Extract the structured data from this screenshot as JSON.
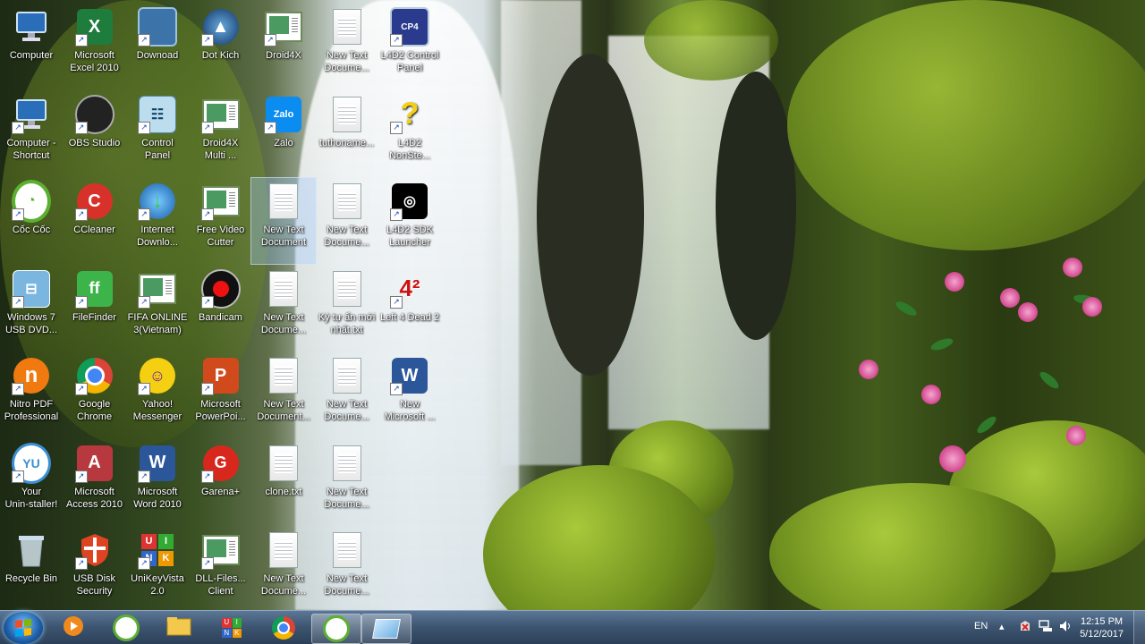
{
  "desktop": {
    "icons": [
      {
        "label": "Computer",
        "type": "computer"
      },
      {
        "label": "Microsoft\nExcel 2010",
        "type": "excel"
      },
      {
        "label": "Downoad",
        "type": "folder-blue"
      },
      {
        "label": "Dot Kich",
        "type": "dotkich"
      },
      {
        "label": "Droid4X",
        "type": "win"
      },
      {
        "label": "New Text\nDocume...",
        "type": "doc"
      },
      {
        "label": "L4D2 Control\nPanel",
        "type": "l4d2cp"
      },
      {
        "label": "Computer -\nShortcut",
        "type": "computer"
      },
      {
        "label": "OBS Studio",
        "type": "obs"
      },
      {
        "label": "Control\nPanel",
        "type": "controlpanel"
      },
      {
        "label": "Droid4X\nMulti ...",
        "type": "win"
      },
      {
        "label": "Zalo",
        "type": "zalo"
      },
      {
        "label": "tuthoname...",
        "type": "doc"
      },
      {
        "label": "L4D2\nNonSte...",
        "type": "question"
      },
      {
        "label": "Cốc Cốc",
        "type": "coccoc"
      },
      {
        "label": "CCleaner",
        "type": "ccleaner"
      },
      {
        "label": "Internet\nDownlo...",
        "type": "idm"
      },
      {
        "label": "Free Video\nCutter",
        "type": "win"
      },
      {
        "label": "New Text\nDocument\n(5).txt",
        "type": "doc",
        "selected": true
      },
      {
        "label": "New Text\nDocume...",
        "type": "doc"
      },
      {
        "label": "L4D2 SDK\nLauncher",
        "type": "steam"
      },
      {
        "label": "Windows 7\nUSB DVD...",
        "type": "usbdvd"
      },
      {
        "label": "FileFinder",
        "type": "filefinder"
      },
      {
        "label": "FIFA ONLINE\n3(Vietnam)",
        "type": "win"
      },
      {
        "label": "Bandicam",
        "type": "bandicam"
      },
      {
        "label": "New Text\nDocume...",
        "type": "doc"
      },
      {
        "label": "Ký tự ẩn mới\nnhất.txt",
        "type": "doc"
      },
      {
        "label": "Left 4 Dead 2",
        "type": "l4d2"
      },
      {
        "label": "Nitro PDF\nProfessional",
        "type": "nitro"
      },
      {
        "label": "Google\nChrome",
        "type": "chrome"
      },
      {
        "label": "Yahoo!\nMessenger",
        "type": "yahoo"
      },
      {
        "label": "Microsoft\nPowerPoi...",
        "type": "ppt"
      },
      {
        "label": "New Text\nDocument...",
        "type": "doc"
      },
      {
        "label": "New Text\nDocume...",
        "type": "doc"
      },
      {
        "label": "New\nMicrosoft ...",
        "type": "word"
      },
      {
        "label": "Your\nUnin-staller!",
        "type": "uninstaller"
      },
      {
        "label": "Microsoft\nAccess 2010",
        "type": "access"
      },
      {
        "label": "Microsoft\nWord 2010",
        "type": "word"
      },
      {
        "label": "Garena+",
        "type": "garena"
      },
      {
        "label": "clone.txt",
        "type": "doc"
      },
      {
        "label": "New Text\nDocume...",
        "type": "doc"
      },
      {
        "label": "",
        "type": "none"
      },
      {
        "label": "Recycle Bin",
        "type": "recycle"
      },
      {
        "label": "USB Disk\nSecurity",
        "type": "usbsec"
      },
      {
        "label": "UniKeyVista\n2.0",
        "type": "unikey"
      },
      {
        "label": "DLL-Files...\nClient",
        "type": "win"
      },
      {
        "label": "New Text\nDocume...",
        "type": "doc"
      },
      {
        "label": "New Text\nDocume...",
        "type": "doc"
      },
      {
        "label": "",
        "type": "none"
      }
    ]
  },
  "taskbar": {
    "pinned": [
      {
        "name": "media-player-icon",
        "active": false
      },
      {
        "name": "coccoc-icon",
        "active": false
      },
      {
        "name": "explorer-icon",
        "active": false
      },
      {
        "name": "unikey-icon",
        "active": false
      },
      {
        "name": "chrome-icon",
        "active": false
      },
      {
        "name": "coccoc-window-icon",
        "active": true
      },
      {
        "name": "glass-window-icon",
        "active": true
      }
    ],
    "language": "EN",
    "time": "12:15 PM",
    "date": "5/12/2017"
  }
}
